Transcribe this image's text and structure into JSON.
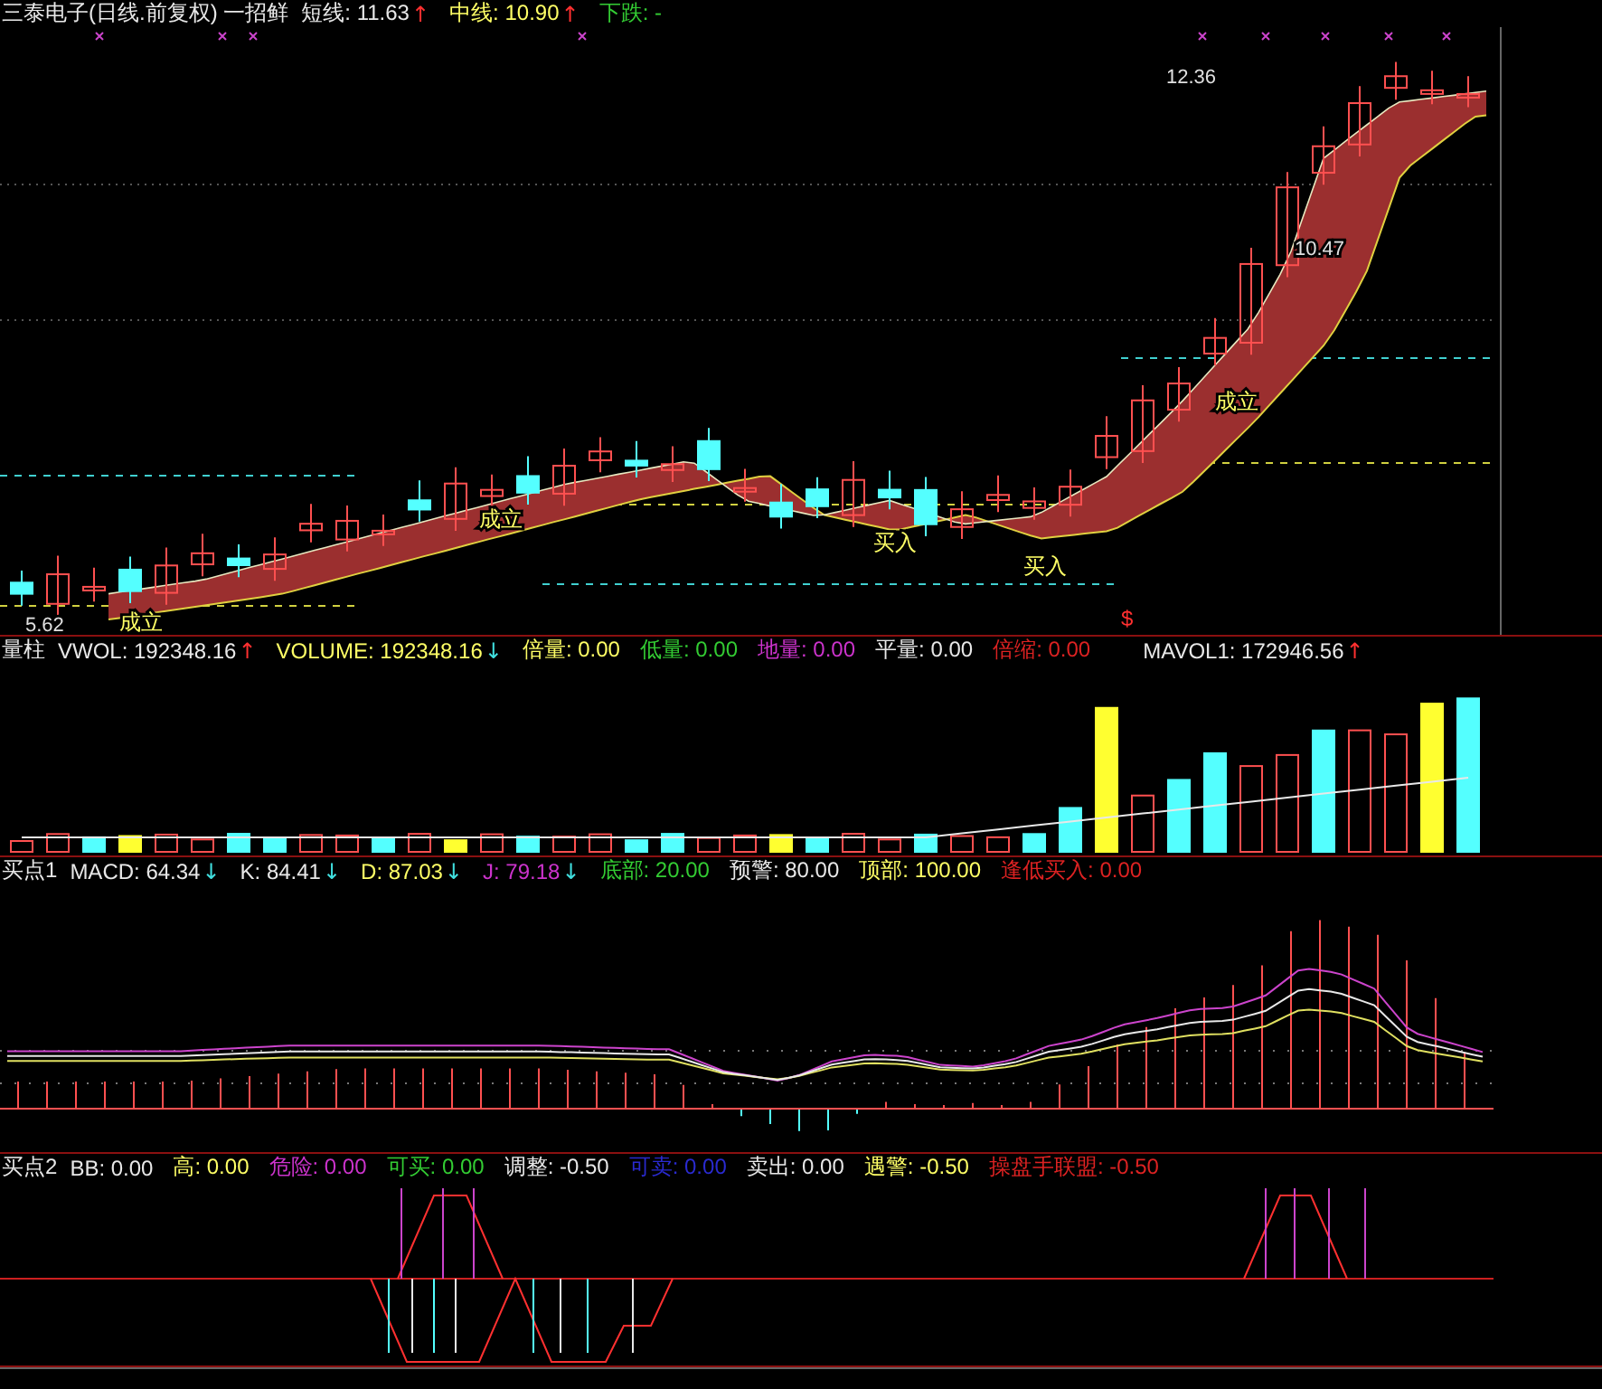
{
  "price_panel": {
    "items": [
      {
        "kind": "title",
        "text": "三泰电子(日线.前复权) 一招鲜",
        "color": "#e8e8e8"
      },
      {
        "kind": "value",
        "text": "短线: 11.63",
        "color": "#e8e8e8",
        "arrow": {
          "text": "↑",
          "color": "#ff3030"
        }
      },
      {
        "kind": "value",
        "text": "中线: 10.90",
        "color": "#ffff66",
        "arrow": {
          "text": "↑",
          "color": "#ff3030"
        }
      },
      {
        "kind": "value",
        "text": "下跌: -",
        "color": "#33cc33"
      }
    ],
    "annotations": [
      {
        "kind": "price",
        "text": "12.36"
      },
      {
        "kind": "price",
        "text": "10.47"
      },
      {
        "kind": "price",
        "text": "5.62"
      },
      {
        "kind": "signal",
        "text": "成立"
      },
      {
        "kind": "signal",
        "text": "成立"
      },
      {
        "kind": "signal",
        "text": "成立"
      },
      {
        "kind": "signal",
        "text": "买入"
      },
      {
        "kind": "signal",
        "text": "买入"
      },
      {
        "kind": "mark",
        "text": "$"
      }
    ]
  },
  "volume_panel": {
    "items": [
      {
        "kind": "title",
        "text": "量柱",
        "color": "#e8e8e8"
      },
      {
        "kind": "value",
        "text": "VWOL: 192348.16",
        "color": "#e8e8e8",
        "arrow": {
          "text": "↑",
          "color": "#ff3030"
        }
      },
      {
        "kind": "value",
        "text": "VOLUME: 192348.16",
        "color": "#ffff66",
        "arrow": {
          "text": "↓",
          "color": "#40e0e0"
        }
      },
      {
        "kind": "value",
        "text": "倍量: 0.00",
        "color": "#ffff66"
      },
      {
        "kind": "value",
        "text": "低量: 0.00",
        "color": "#33cc33"
      },
      {
        "kind": "value",
        "text": "地量: 0.00",
        "color": "#cc33cc"
      },
      {
        "kind": "value",
        "text": "平量: 0.00",
        "color": "#e8e8e8"
      },
      {
        "kind": "value",
        "text": "倍缩: 0.00",
        "color": "#dd2222"
      },
      {
        "kind": "spaced",
        "text": "MAVOL1: 172946.56",
        "color": "#e8e8e8",
        "arrow": {
          "text": "↑",
          "color": "#ff3030"
        }
      }
    ]
  },
  "macd_panel": {
    "items": [
      {
        "kind": "title",
        "text": "买点1",
        "color": "#e8e8e8"
      },
      {
        "kind": "value",
        "text": "MACD: 64.34",
        "color": "#e8e8e8",
        "arrow": {
          "text": "↓",
          "color": "#40e0e0"
        }
      },
      {
        "kind": "value",
        "text": "K: 84.41",
        "color": "#e8e8e8",
        "arrow": {
          "text": "↓",
          "color": "#40e0e0"
        }
      },
      {
        "kind": "value",
        "text": "D: 87.03",
        "color": "#ffff66",
        "arrow": {
          "text": "↓",
          "color": "#40e0e0"
        }
      },
      {
        "kind": "value",
        "text": "J: 79.18",
        "color": "#cc33cc",
        "arrow": {
          "text": "↓",
          "color": "#40e0e0"
        }
      },
      {
        "kind": "value",
        "text": "底部: 20.00",
        "color": "#33cc33"
      },
      {
        "kind": "value",
        "text": "预警: 80.00",
        "color": "#e8e8e8"
      },
      {
        "kind": "value",
        "text": "顶部: 100.00",
        "color": "#ffff66"
      },
      {
        "kind": "value",
        "text": "逢低买入: 0.00",
        "color": "#dd2222"
      }
    ]
  },
  "signal_panel": {
    "items": [
      {
        "kind": "title",
        "text": "买点2",
        "color": "#e8e8e8"
      },
      {
        "kind": "value",
        "text": "BB: 0.00",
        "color": "#e8e8e8"
      },
      {
        "kind": "value",
        "text": "高: 0.00",
        "color": "#ffff66"
      },
      {
        "kind": "value",
        "text": "危险: 0.00",
        "color": "#cc33cc"
      },
      {
        "kind": "value",
        "text": "可买: 0.00",
        "color": "#33cc33"
      },
      {
        "kind": "value",
        "text": "调整: -0.50",
        "color": "#e8e8e8"
      },
      {
        "kind": "value",
        "text": "可卖: 0.00",
        "color": "#2a2ad0"
      },
      {
        "kind": "value",
        "text": "卖出: 0.00",
        "color": "#e8e8e8"
      },
      {
        "kind": "value",
        "text": "遇警: -0.50",
        "color": "#ffff66"
      },
      {
        "kind": "value",
        "text": "操盘手联盟: -0.50",
        "color": "#dd2222"
      }
    ]
  }
}
